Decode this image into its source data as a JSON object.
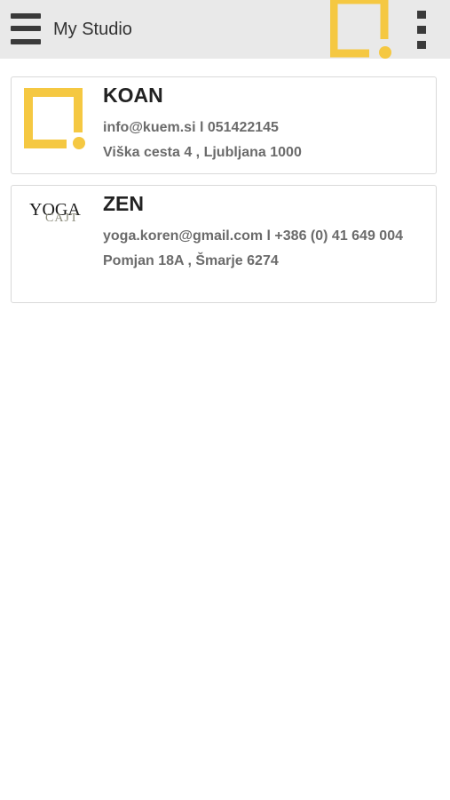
{
  "app_bar": {
    "title": "My Studio",
    "menu_icon": "hamburger-menu-icon",
    "logo_icon": "studio-logo-icon",
    "more_icon": "vertical-dots-icon",
    "logo_color": "#f5c842"
  },
  "studios": [
    {
      "name": "KOAN",
      "contact": "info@kuem.si l 051422145",
      "address": "Viška cesta 4 , Ljubljana  1000",
      "logo": "koan-logo-icon"
    },
    {
      "name": "ZEN",
      "contact": "yoga.koren@gmail.com l +386 (0) 41 649 004",
      "address": "Pomjan 18A , Šmarje  6274",
      "logo": "yoga-cajt-logo",
      "logo_text_top": "YOGA",
      "logo_text_bottom": "CAJT"
    }
  ],
  "colors": {
    "accent_yellow": "#f5c842",
    "topbar_bg": "#e9e9e9",
    "text_dark": "#222222",
    "text_muted": "#6b6b6b"
  }
}
